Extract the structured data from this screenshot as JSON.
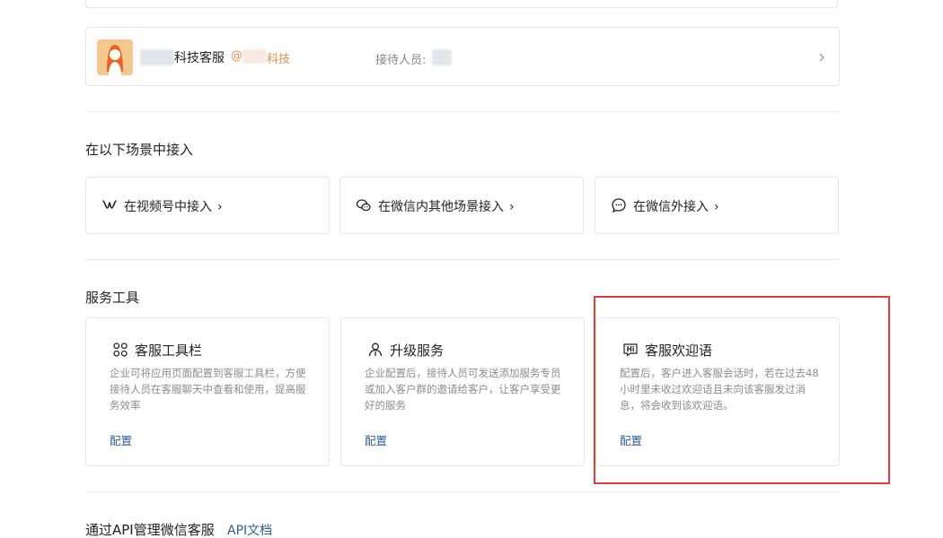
{
  "account": {
    "name_suffix": "科技客服",
    "org_at": "@",
    "org_suffix": "科技",
    "receiver_label": "接待人员:"
  },
  "scenes": {
    "title": "在以下场景中接入",
    "items": [
      {
        "label": "在视频号中接入",
        "icon": "channels-icon"
      },
      {
        "label": "在微信内其他场景接入",
        "icon": "wechat-icon"
      },
      {
        "label": "在微信外接入",
        "icon": "chat-bubble-icon"
      }
    ]
  },
  "tools": {
    "title": "服务工具",
    "items": [
      {
        "title": "客服工具栏",
        "desc": "企业可将应用页面配置到客服工具栏，方便接待人员在客服聊天中查看和使用，提高服务效率",
        "action": "配置",
        "icon": "grid-icon"
      },
      {
        "title": "升级服务",
        "desc": "企业配置后，接待人员可发送添加服务专员或加入客户群的邀请给客户，让客户享受更好的服务",
        "action": "配置",
        "icon": "upgrade-user-icon"
      },
      {
        "title": "客服欢迎语",
        "desc": "配置后，客户进入客服会话时，若在过去48小时里未收过欢迎语且未向该客服发过消息，将会收到该欢迎语。",
        "action": "配置",
        "icon": "hi-icon"
      }
    ]
  },
  "api": {
    "title": "通过API管理微信客服",
    "link": "API文档"
  },
  "colors": {
    "link": "#2c5e9e",
    "org": "#f08a48",
    "highlight": "#e63b3b",
    "border": "#e4e6e9"
  }
}
